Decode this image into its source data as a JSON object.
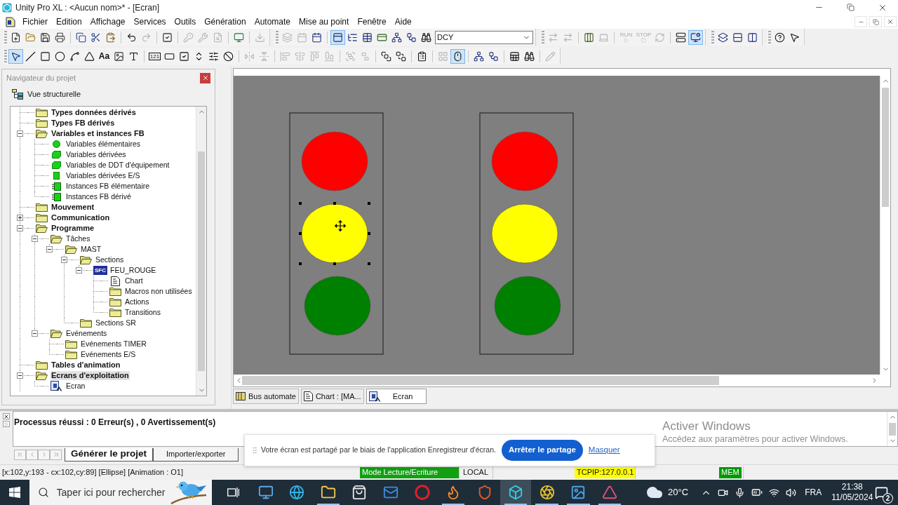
{
  "window": {
    "title": "Unity Pro XL : <Aucun nom>* - [Ecran]"
  },
  "menu": [
    "Fichier",
    "Edition",
    "Affichage",
    "Services",
    "Outils",
    "Génération",
    "Automate",
    "Mise au point",
    "Fenêtre",
    "Aide"
  ],
  "toolbars": [
    {
      "bands": [
        {
          "groups": [
            [
              {
                "kind": "new",
                "disabled": false,
                "pressed": false
              },
              {
                "kind": "open",
                "disabled": false,
                "pressed": false
              },
              {
                "kind": "save",
                "disabled": false,
                "pressed": false
              },
              {
                "kind": "print",
                "disabled": false,
                "pressed": false
              }
            ],
            [
              {
                "kind": "copy",
                "disabled": false,
                "pressed": false
              },
              {
                "kind": "cut",
                "disabled": false,
                "pressed": false
              },
              {
                "kind": "paste",
                "disabled": false,
                "pressed": false
              }
            ],
            [
              {
                "kind": "undo",
                "disabled": false,
                "pressed": false
              },
              {
                "kind": "redo",
                "disabled": true,
                "pressed": false
              }
            ],
            [
              {
                "kind": "analyze",
                "disabled": false,
                "pressed": false
              }
            ],
            [
              {
                "kind": "key",
                "disabled": true,
                "pressed": false
              },
              {
                "kind": "wrench",
                "disabled": true,
                "pressed": false
              },
              {
                "kind": "file-search",
                "disabled": true,
                "pressed": false
              }
            ],
            [
              {
                "kind": "monitor",
                "disabled": false,
                "pressed": false
              }
            ],
            [
              {
                "kind": "download",
                "disabled": true,
                "pressed": false
              }
            ]
          ]
        },
        {
          "groups": [
            [
              {
                "kind": "layers",
                "disabled": true,
                "pressed": false
              },
              {
                "kind": "calendar",
                "disabled": true,
                "pressed": false
              },
              {
                "kind": "calendar",
                "disabled": false,
                "pressed": false
              }
            ],
            [
              {
                "kind": "window",
                "disabled": false,
                "pressed": true
              },
              {
                "kind": "tree",
                "disabled": false,
                "pressed": false
              },
              {
                "kind": "table",
                "disabled": false,
                "pressed": false
              },
              {
                "kind": "card",
                "disabled": false,
                "pressed": false
              },
              {
                "kind": "network",
                "disabled": false,
                "pressed": false
              },
              {
                "kind": "workflow",
                "disabled": false,
                "pressed": false
              },
              {
                "kind": "binoculars",
                "disabled": false,
                "pressed": false
              }
            ]
          ],
          "combo": {
            "value": "DCY"
          }
        },
        {
          "groups": [
            [
              {
                "kind": "transfer",
                "disabled": true,
                "pressed": false
              },
              {
                "kind": "transfer",
                "disabled": true,
                "pressed": false
              }
            ],
            [
              {
                "kind": "columns",
                "disabled": false,
                "pressed": false
              },
              {
                "kind": "laptop",
                "disabled": true,
                "pressed": false
              }
            ],
            [
              {
                "kind": "run",
                "label": "RUN",
                "disabled": true,
                "pressed": false
              },
              {
                "kind": "stop",
                "label": "STOP",
                "disabled": true,
                "pressed": false
              },
              {
                "kind": "refresh",
                "disabled": true,
                "pressed": false
              }
            ],
            [
              {
                "kind": "server",
                "disabled": false,
                "pressed": false
              },
              {
                "kind": "monitor-cog",
                "disabled": false,
                "pressed": true
              }
            ]
          ]
        },
        {
          "groups": [
            [
              {
                "kind": "cascade",
                "disabled": false,
                "pressed": false
              },
              {
                "kind": "rows",
                "disabled": false,
                "pressed": false
              },
              {
                "kind": "split",
                "disabled": false,
                "pressed": false
              }
            ]
          ]
        },
        {
          "groups": [
            [
              {
                "kind": "help",
                "disabled": false,
                "pressed": false
              },
              {
                "kind": "pointer-help",
                "disabled": false,
                "pressed": false
              }
            ]
          ]
        }
      ]
    },
    {
      "bands": [
        {
          "groups": [
            [
              {
                "kind": "pointer",
                "disabled": false,
                "pressed": true
              },
              {
                "kind": "line",
                "disabled": false,
                "pressed": false
              },
              {
                "kind": "rect",
                "disabled": false,
                "pressed": false
              },
              {
                "kind": "ellipse",
                "disabled": false,
                "pressed": false
              },
              {
                "kind": "arc",
                "disabled": false,
                "pressed": false
              },
              {
                "kind": "polygon",
                "disabled": false,
                "pressed": false
              },
              {
                "kind": "text",
                "label": "Aa",
                "disabled": false,
                "pressed": false
              },
              {
                "kind": "image",
                "disabled": false,
                "pressed": false
              },
              {
                "kind": "type",
                "disabled": false,
                "pressed": false
              }
            ],
            [
              {
                "kind": "numeric",
                "label": "121",
                "disabled": false,
                "pressed": false
              },
              {
                "kind": "rect-button",
                "disabled": false,
                "pressed": false
              },
              {
                "kind": "checkbox",
                "disabled": false,
                "pressed": false
              },
              {
                "kind": "spin",
                "disabled": false,
                "pressed": false
              },
              {
                "kind": "slider",
                "disabled": false,
                "pressed": false
              },
              {
                "kind": "ban",
                "disabled": false,
                "pressed": false
              }
            ],
            [
              {
                "kind": "flip-h",
                "disabled": true,
                "pressed": false
              },
              {
                "kind": "flip-v",
                "disabled": true,
                "pressed": false
              }
            ],
            [
              {
                "kind": "align-1",
                "disabled": true,
                "pressed": false
              },
              {
                "kind": "align-2",
                "disabled": true,
                "pressed": false
              },
              {
                "kind": "align-3",
                "disabled": true,
                "pressed": false
              },
              {
                "kind": "align-4",
                "disabled": true,
                "pressed": false
              }
            ],
            [
              {
                "kind": "group",
                "disabled": true,
                "pressed": false
              },
              {
                "kind": "ungroup",
                "disabled": true,
                "pressed": false
              }
            ],
            [
              {
                "kind": "front",
                "disabled": false,
                "pressed": false
              },
              {
                "kind": "back",
                "disabled": false,
                "pressed": false
              }
            ],
            [
              {
                "kind": "clipboard",
                "disabled": false,
                "pressed": false
              }
            ],
            [
              {
                "kind": "grid",
                "disabled": true,
                "pressed": false
              },
              {
                "kind": "mouse",
                "disabled": false,
                "pressed": true
              }
            ],
            [
              {
                "kind": "network",
                "disabled": false,
                "pressed": false
              },
              {
                "kind": "workflow",
                "disabled": false,
                "pressed": false
              }
            ],
            [
              {
                "kind": "sheet",
                "disabled": false,
                "pressed": false
              },
              {
                "kind": "binoculars",
                "disabled": false,
                "pressed": false
              }
            ],
            [
              {
                "kind": "pen",
                "disabled": true,
                "pressed": false
              }
            ]
          ]
        }
      ]
    }
  ],
  "panel": {
    "title": "Navigateur du projet",
    "view": "Vue structurelle",
    "tree": [
      {
        "label": "Types données dérivés",
        "kind": "folder",
        "selected": false
      },
      {
        "label": "Types FB dérivés",
        "kind": "folder",
        "selected": false
      },
      {
        "label": "Variables et instances FB",
        "kind": "folder",
        "selected": false,
        "expanded": true,
        "children": [
          {
            "label": "Variables élémentaires",
            "kind": "var-dot",
            "selected": false
          },
          {
            "label": "Variables dérivées",
            "kind": "var-block",
            "selected": false
          },
          {
            "label": "Variables de DDT d'équipement",
            "kind": "var-block",
            "selected": false
          },
          {
            "label": "Variables dérivées E/S",
            "kind": "var-square",
            "selected": false
          },
          {
            "label": "Instances FB élémentaire",
            "kind": "fb",
            "selected": false
          },
          {
            "label": "Instances FB dérivé",
            "kind": "fb",
            "selected": false
          }
        ]
      },
      {
        "label": "Mouvement",
        "kind": "folder",
        "selected": false
      },
      {
        "label": "Communication",
        "kind": "folder",
        "selected": false,
        "expanded": false
      },
      {
        "label": "Programme",
        "kind": "folder",
        "selected": false,
        "expanded": true,
        "children": [
          {
            "label": "Tâches",
            "kind": "folder",
            "selected": false,
            "expanded": true,
            "children": [
              {
                "label": "MAST",
                "kind": "folder",
                "selected": false,
                "expanded": true,
                "children": [
                  {
                    "label": "Sections",
                    "kind": "folder",
                    "selected": false,
                    "expanded": true,
                    "children": [
                      {
                        "label": "FEU_ROUGE",
                        "kind": "section",
                        "tag": "SFC",
                        "selected": false,
                        "expanded": true,
                        "children": [
                          {
                            "label": "Chart",
                            "kind": "chart",
                            "selected": false
                          },
                          {
                            "label": "Macros non utilisées",
                            "kind": "folder",
                            "selected": false
                          },
                          {
                            "label": "Actions",
                            "kind": "folder",
                            "selected": false
                          },
                          {
                            "label": "Transitions",
                            "kind": "folder",
                            "selected": false
                          }
                        ]
                      }
                    ]
                  },
                  {
                    "label": "Sections SR",
                    "kind": "folder",
                    "selected": false
                  }
                ]
              }
            ]
          },
          {
            "label": "Evénements",
            "kind": "folder",
            "selected": false,
            "expanded": true,
            "children": [
              {
                "label": "Evénements TIMER",
                "kind": "folder",
                "selected": false
              },
              {
                "label": "Evénements E/S",
                "kind": "folder",
                "selected": false
              }
            ]
          }
        ]
      },
      {
        "label": "Tables d'animation",
        "kind": "folder",
        "selected": false
      },
      {
        "label": "Ecrans d'exploitation",
        "kind": "folder",
        "selected": true,
        "expanded": true,
        "children": [
          {
            "label": "Ecran",
            "kind": "screen",
            "selected": false
          }
        ]
      }
    ]
  },
  "canvas": {
    "objects": [
      {
        "kind": "traffic-light",
        "lights": [
          {
            "color": "#ff0000",
            "selected": false
          },
          {
            "color": "#ffff00",
            "selected": true
          },
          {
            "color": "#008000",
            "selected": false
          }
        ]
      },
      {
        "kind": "traffic-light",
        "lights": [
          {
            "color": "#ff0000",
            "selected": false
          },
          {
            "color": "#ffff00",
            "selected": false
          },
          {
            "color": "#008000",
            "selected": false
          }
        ]
      }
    ],
    "tabs": [
      {
        "label": "Bus automate",
        "kind": "bus",
        "selected": false
      },
      {
        "label": "Chart : [MA...",
        "kind": "chart",
        "selected": false
      },
      {
        "label": "Ecran",
        "kind": "screen",
        "selected": true
      }
    ]
  },
  "output": {
    "message": "Processus réussi : 0 Erreur(s) , 0 Avertissement(s)",
    "tabs": [
      {
        "label": "Générer le projet",
        "selected": true
      },
      {
        "label": "Importer/exporter",
        "selected": false
      }
    ]
  },
  "status_bar": {
    "text": "[x:102,y:193 - cx:102,cy:89] [Ellipse] [Animation : O1]",
    "fields": [
      {
        "label": "Mode Lecture/Ecriture",
        "color": "#12a012"
      },
      {
        "label": "LOCAL",
        "color": "#f0f0f0"
      },
      {
        "label": "TCPIP:127.0.0.1",
        "color": "#ffff00"
      },
      {
        "label": "MEM",
        "color": "#009a00"
      }
    ]
  },
  "notification": {
    "message": "Votre écran est partagé par le biais de l'application Enregistreur d'écran.",
    "button": "Arrêter le partage",
    "link": "Masquer"
  },
  "activation": {
    "title": "Activer Windows",
    "message": "Accédez aux paramètres pour activer Windows."
  },
  "taskbar": {
    "search_placeholder": "Taper ici pour rechercher",
    "apps": [
      {
        "kind": "computer",
        "running": false,
        "selected": false
      },
      {
        "kind": "globe",
        "running": false,
        "selected": false
      },
      {
        "kind": "files",
        "running": true,
        "selected": false
      },
      {
        "kind": "store",
        "running": false,
        "selected": false
      },
      {
        "kind": "mail",
        "running": false,
        "selected": false
      },
      {
        "kind": "ring",
        "running": false,
        "selected": false
      },
      {
        "kind": "flame",
        "running": true,
        "selected": false
      },
      {
        "kind": "shield",
        "running": false,
        "selected": false
      },
      {
        "kind": "cube",
        "running": true,
        "selected": true
      },
      {
        "kind": "aperture",
        "running": true,
        "selected": false
      },
      {
        "kind": "photo",
        "running": true,
        "selected": false
      },
      {
        "kind": "flag",
        "running": true,
        "selected": false
      }
    ],
    "weather": "20°C",
    "language": "FRA",
    "time": "21:38",
    "date": "11/05/2024",
    "notifications": "2"
  }
}
